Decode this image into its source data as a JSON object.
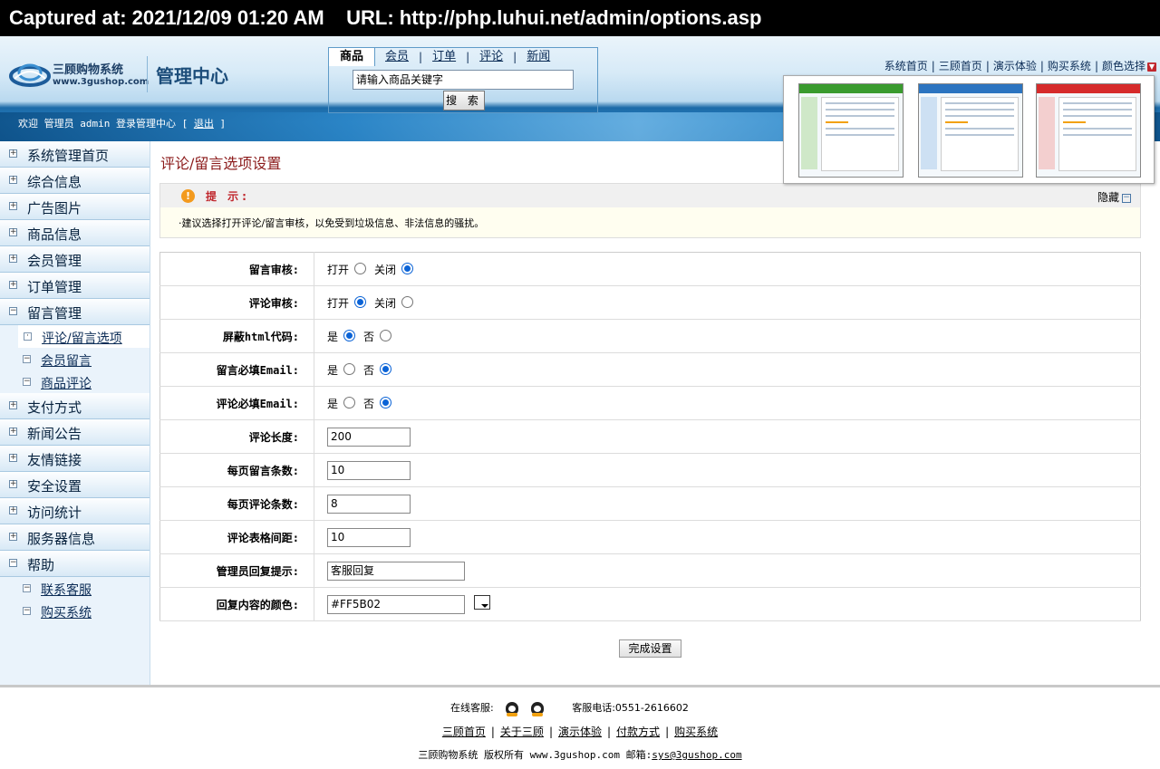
{
  "capture": {
    "text": "Captured at: 2021/12/09 01:20 AM    URL: http://php.luhui.net/admin/options.asp"
  },
  "header": {
    "brand": "三顾购物系统",
    "site": "www.3gushop.com",
    "title": "管理中心",
    "search": {
      "tabs": [
        "商品",
        "会员",
        "订单",
        "评论",
        "新闻"
      ],
      "active_tab": "商品",
      "input_value": "请输入商品关键字",
      "button": "搜 索"
    },
    "top_links": [
      "系统首页",
      "三顾首页",
      "演示体验",
      "购买系统",
      "颜色选择"
    ],
    "welcome": "欢迎 管理员 admin 登录管理中心 [",
    "logout": "退出",
    "welcome_end": "]",
    "theme_colors": [
      "#3a9b2e",
      "#2c74c0",
      "#d62b2b"
    ]
  },
  "sidebar": {
    "items": [
      {
        "label": "系统管理首页",
        "expanded": false
      },
      {
        "label": "综合信息",
        "expanded": false
      },
      {
        "label": "广告图片",
        "expanded": false
      },
      {
        "label": "商品信息",
        "expanded": false
      },
      {
        "label": "会员管理",
        "expanded": false
      },
      {
        "label": "订单管理",
        "expanded": false
      },
      {
        "label": "留言管理",
        "expanded": true
      },
      {
        "label": "支付方式",
        "expanded": false
      },
      {
        "label": "新闻公告",
        "expanded": false
      },
      {
        "label": "友情链接",
        "expanded": false
      },
      {
        "label": "安全设置",
        "expanded": false
      },
      {
        "label": "访问统计",
        "expanded": false
      },
      {
        "label": "服务器信息",
        "expanded": false
      },
      {
        "label": "帮助",
        "expanded": true
      }
    ],
    "sub_guestbook": [
      "评论/留言选项",
      "会员留言",
      "商品评论"
    ],
    "sub_help": [
      "联系客服",
      "购买系统"
    ]
  },
  "main": {
    "title": "评论/留言选项设置",
    "tip": {
      "title": "提 示:",
      "hide": "隐藏",
      "body": "·建议选择打开评论/留言审核，以免受到垃圾信息、非法信息的骚扰。"
    },
    "options": {
      "guestbook_review": {
        "label": "留言审核:",
        "opt1": "打开",
        "opt2": "关闭",
        "selected": "关闭"
      },
      "comment_review": {
        "label": "评论审核:",
        "opt1": "打开",
        "opt2": "关闭",
        "selected": "打开"
      },
      "block_html": {
        "label": "屏蔽html代码:",
        "opt1": "是",
        "opt2": "否",
        "selected": "是"
      },
      "guestbook_email": {
        "label": "留言必填Email:",
        "opt1": "是",
        "opt2": "否",
        "selected": "否"
      },
      "comment_email": {
        "label": "评论必填Email:",
        "opt1": "是",
        "opt2": "否",
        "selected": "否"
      },
      "comment_length": {
        "label": "评论长度:",
        "value": "200"
      },
      "guestbook_per_page": {
        "label": "每页留言条数:",
        "value": "10"
      },
      "comments_per_page": {
        "label": "每页评论条数:",
        "value": "8"
      },
      "comment_spacing": {
        "label": "评论表格间距:",
        "value": "10"
      },
      "admin_reply_hint": {
        "label": "管理员回复提示:",
        "value": "客服回复"
      },
      "reply_color": {
        "label": "回复内容的颜色:",
        "value": "#FF5B02"
      }
    },
    "submit": "完成设置"
  },
  "footer": {
    "online_label": "在线客服:",
    "phone": "客服电话:0551-2616602",
    "links": [
      "三顾首页",
      "关于三顾",
      "演示体验",
      "付款方式",
      "购买系统"
    ],
    "copyright": "三顾购物系统 版权所有 www.3gushop.com 邮箱:",
    "email": "sys@3gushop.com"
  }
}
